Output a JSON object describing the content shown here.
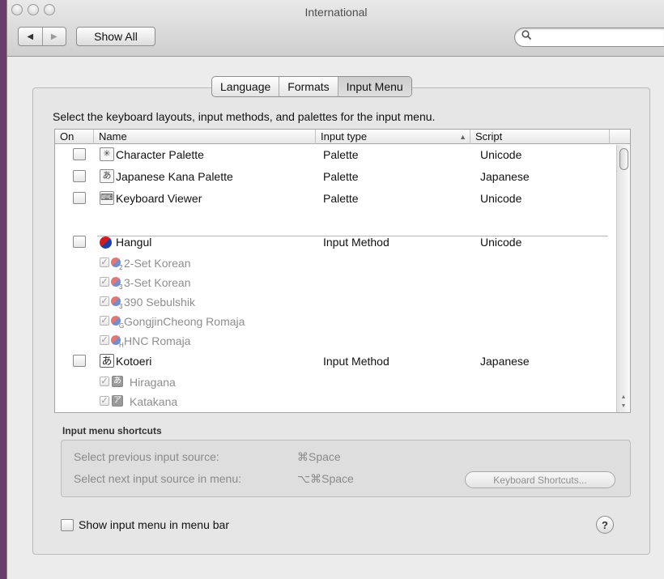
{
  "window": {
    "title": "International"
  },
  "toolbar": {
    "back_icon": "back-arrow-icon",
    "forward_icon": "forward-arrow-icon",
    "show_all_label": "Show All",
    "search_placeholder": ""
  },
  "tabs": [
    {
      "label": "Language",
      "active": false
    },
    {
      "label": "Formats",
      "active": false
    },
    {
      "label": "Input Menu",
      "active": true
    }
  ],
  "instruction": "Select the keyboard layouts, input methods, and palettes for the input menu.",
  "table": {
    "columns": [
      "On",
      "Name",
      "Input type",
      "Script"
    ],
    "sort_indicator": "▲",
    "palettes": [
      {
        "name": "Character Palette",
        "input_type": "Palette",
        "script": "Unicode",
        "checked": false,
        "icon": "character-palette-icon"
      },
      {
        "name": "Japanese Kana Palette",
        "input_type": "Palette",
        "script": "Japanese",
        "checked": false,
        "icon": "kana-palette-icon"
      },
      {
        "name": "Keyboard Viewer",
        "input_type": "Palette",
        "script": "Unicode",
        "checked": false,
        "icon": "keyboard-viewer-icon"
      }
    ],
    "hangul": {
      "name": "Hangul",
      "input_type": "Input Method",
      "script": "Unicode",
      "checked": false,
      "icon": "korean-flag-icon"
    },
    "hangul_sub": [
      {
        "name": "2-Set Korean",
        "badge": "2"
      },
      {
        "name": "3-Set Korean",
        "badge": "3"
      },
      {
        "name": "390 Sebulshik",
        "badge": "3"
      },
      {
        "name": "GongjinCheong Romaja",
        "badge": "G"
      },
      {
        "name": "HNC Romaja",
        "badge": "H"
      }
    ],
    "kotoeri": {
      "name": "Kotoeri",
      "input_type": "Input Method",
      "script": "Japanese",
      "checked": false,
      "icon_glyph": "あ"
    },
    "kotoeri_sub": [
      {
        "name": "Hiragana",
        "glyph": "あ"
      },
      {
        "name": "Katakana",
        "glyph": "ア"
      }
    ]
  },
  "shortcuts": {
    "title": "Input menu shortcuts",
    "prev_label": "Select previous input source:",
    "prev_key": "⌘Space",
    "next_label": "Select next input source in menu:",
    "next_key": "⌥⌘Space",
    "button_label": "Keyboard Shortcuts..."
  },
  "show_in_menubar": {
    "label": "Show input menu in menu bar",
    "checked": false
  },
  "help": "?"
}
